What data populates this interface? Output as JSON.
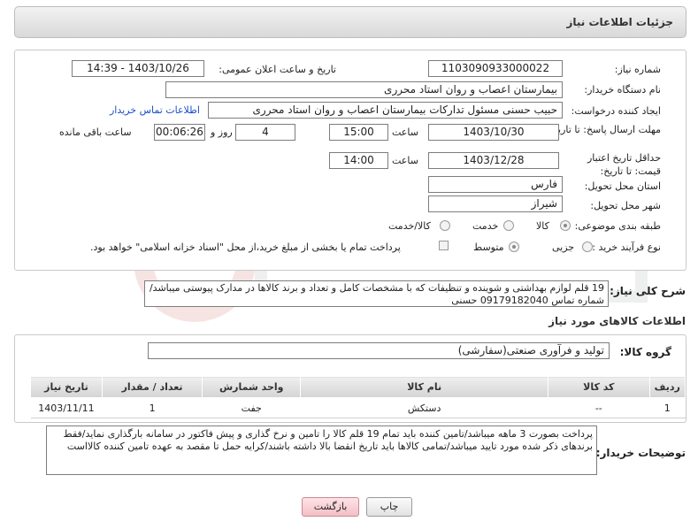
{
  "header": {
    "title": "جزئیات اطلاعات نیاز"
  },
  "form": {
    "need_number": {
      "label": "شماره نیاز:",
      "value": "1103090933000022"
    },
    "announce_datetime": {
      "label": "تاریخ و ساعت اعلان عمومی:",
      "value": "1403/10/26 - 14:39"
    },
    "buyer_org": {
      "label": "نام دستگاه خریدار:",
      "value": "بیمارستان اعصاب و روان استاد محرری"
    },
    "requester": {
      "label": "ایجاد کننده درخواست:",
      "value": "حبیب حسنی مسئول تدارکات بیمارستان اعصاب و روان استاد محرری",
      "contact_link": "اطلاعات تماس خریدار"
    },
    "reply_deadline": {
      "label": "مهلت ارسال پاسخ: تا تاریخ:",
      "date": "1403/10/30",
      "time_label": "ساعت",
      "time": "15:00",
      "days": "4",
      "days_label": "روز و",
      "remaining": "00:06:26",
      "remaining_label": "ساعت باقی مانده"
    },
    "price_validity": {
      "label": "حداقل تاریخ اعتبار قیمت: تا تاریخ:",
      "date": "1403/12/28",
      "time_label": "ساعت",
      "time": "14:00"
    },
    "province": {
      "label": "استان محل تحویل:",
      "value": "فارس"
    },
    "city": {
      "label": "شهر محل تحویل:",
      "value": "شیراز"
    },
    "category": {
      "label": "طبقه بندی موضوعی:",
      "options": [
        "کالا",
        "خدمت",
        "کالا/خدمت"
      ]
    },
    "purchase_type": {
      "label": "نوع فرآیند خرید :",
      "options": [
        "جزیی",
        "متوسط"
      ],
      "payment_note": "پرداخت تمام یا بخشی از مبلغ خرید،از محل \"اسناد خزانه اسلامی\" خواهد بود."
    }
  },
  "summary": {
    "label": "شرح کلی نیاز:",
    "text": "19 قلم لوازم بهداشتی و شوینده و تنظیفات که با مشخصات کامل و تعداد و برند کالاها در مدارک پیوستی میباشد/شماره تماس 09179182040 حسنی"
  },
  "goods": {
    "title": "اطلاعات کالاهای مورد نیاز",
    "group_label": "گروه کالا:",
    "group_value": "تولید و فرآوری صنعتی(سفارشی)",
    "columns": [
      "ردیف",
      "کد کالا",
      "نام کالا",
      "واحد شمارش",
      "تعداد / مقدار",
      "تاریخ نیاز"
    ],
    "rows": [
      {
        "row": "1",
        "code": "--",
        "name": "دستکش",
        "unit": "جفت",
        "qty": "1",
        "date": "1403/11/11"
      }
    ]
  },
  "buyer_notes": {
    "label": "توضیحات خریدار:",
    "text": "پرداخت بصورت 3 ماهه میباشد/تامین کننده باید تمام 19 قلم کالا را تامین و نرخ گذاری و پیش فاکتور در سامانه بارگذاری نماید/فقط برندهای ذکر شده مورد تایید میباشد/تمامی کالاها باید تاریخ انقضا بالا داشته باشند/کرایه حمل تا مقصد به عهده تامین کننده کالااست"
  },
  "actions": {
    "print": "چاپ",
    "back": "بازگشت"
  },
  "colors": {
    "link": "#1a4fc9",
    "back_button": "#f4bfc6",
    "watermark": "#c0392b"
  }
}
